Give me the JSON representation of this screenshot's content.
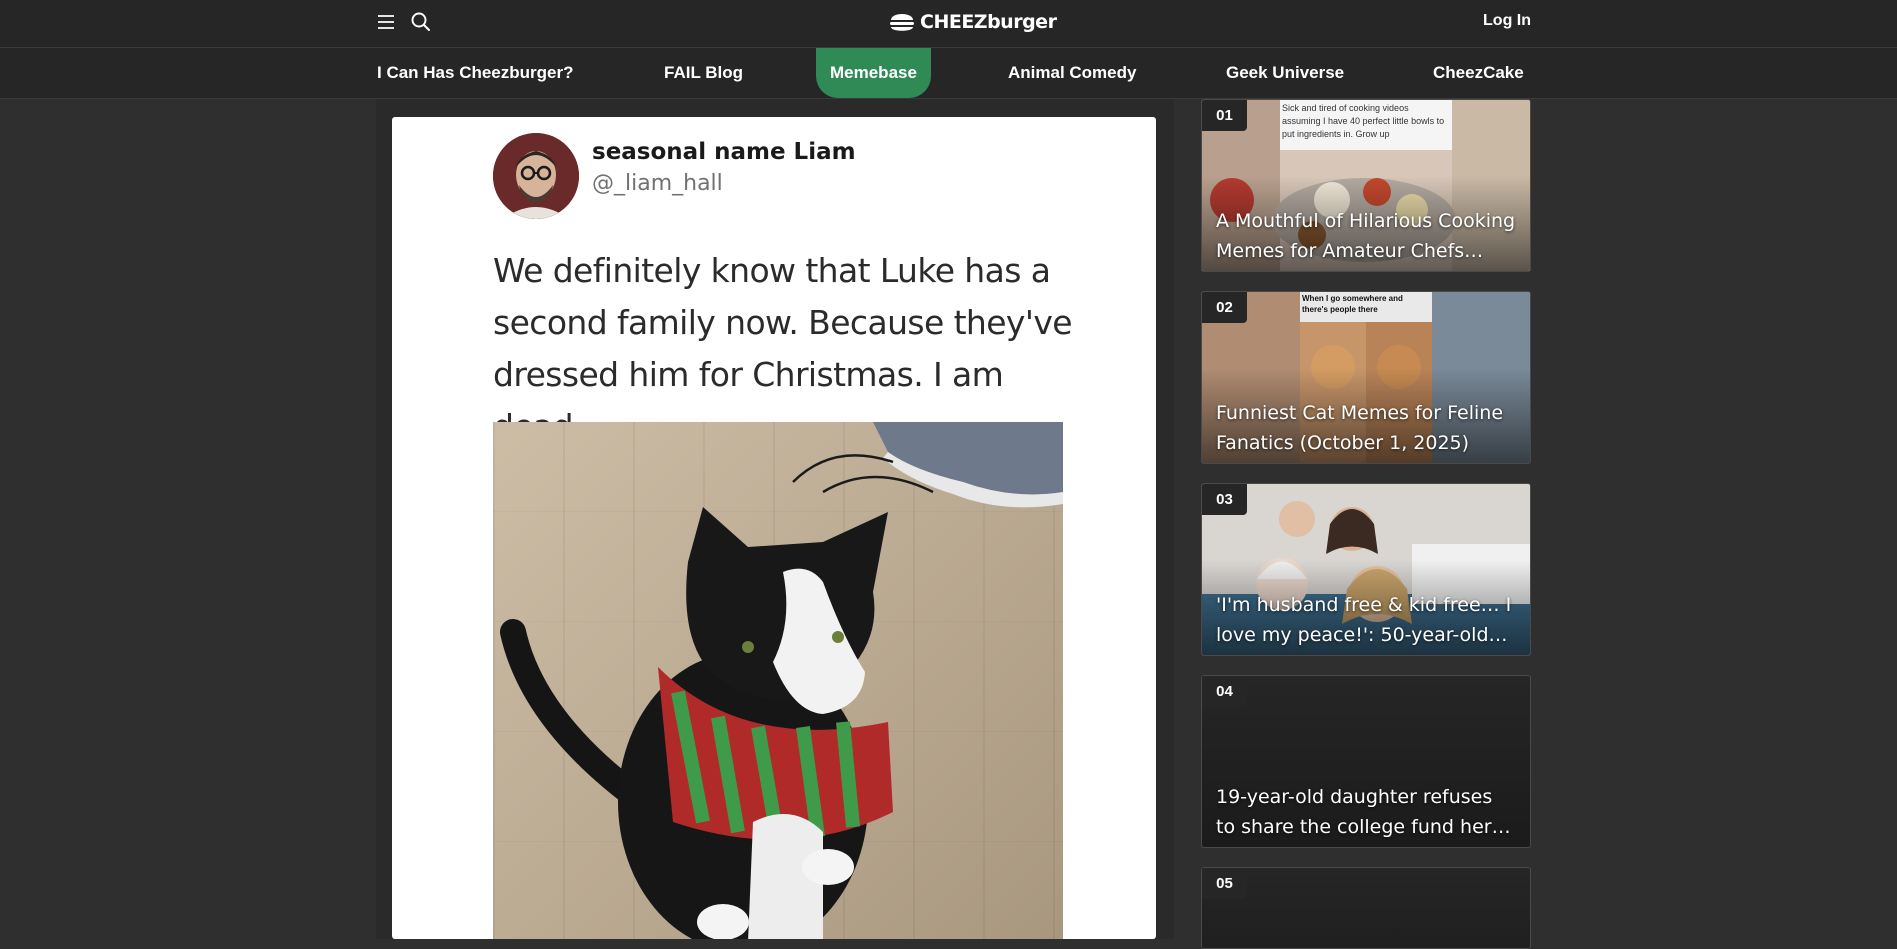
{
  "header": {
    "logo_text": "CHEEZburger",
    "login_label": "Log In"
  },
  "nav": {
    "items": [
      {
        "label": "I Can Has Cheezburger?"
      },
      {
        "label": "FAIL Blog"
      },
      {
        "label": "Memebase",
        "active": true
      },
      {
        "label": "Animal Comedy"
      },
      {
        "label": "Geek Universe"
      },
      {
        "label": "CheezCake"
      }
    ]
  },
  "post": {
    "author_name": "seasonal name Liam",
    "author_handle": "@_liam_hall",
    "text": "We definitely know that Luke has a second family now. Because they've dressed him for Christmas. I am dead."
  },
  "sidebar": {
    "items": [
      {
        "rank": "01",
        "title": "A Mouthful of Hilarious Cooking Memes for Amateur Chefs…",
        "image_caption": "Sick and tired of cooking videos assuming I have 40 perfect little bowls to put ingredients in. Grow up"
      },
      {
        "rank": "02",
        "title": "Funniest Cat Memes for Feline Fanatics (October 1, 2025)",
        "image_caption": "When I go somewhere and there's people there"
      },
      {
        "rank": "03",
        "title": "'I'm husband free & kid free… I love my peace!': 50-year-old…"
      },
      {
        "rank": "04",
        "title": "19-year-old daughter refuses to share the college fund her…"
      },
      {
        "rank": "05",
        "title": ""
      }
    ]
  },
  "colors": {
    "brand_green": "#2f8a55",
    "page_bg": "#2f2f2f",
    "bar_bg": "#262626"
  }
}
